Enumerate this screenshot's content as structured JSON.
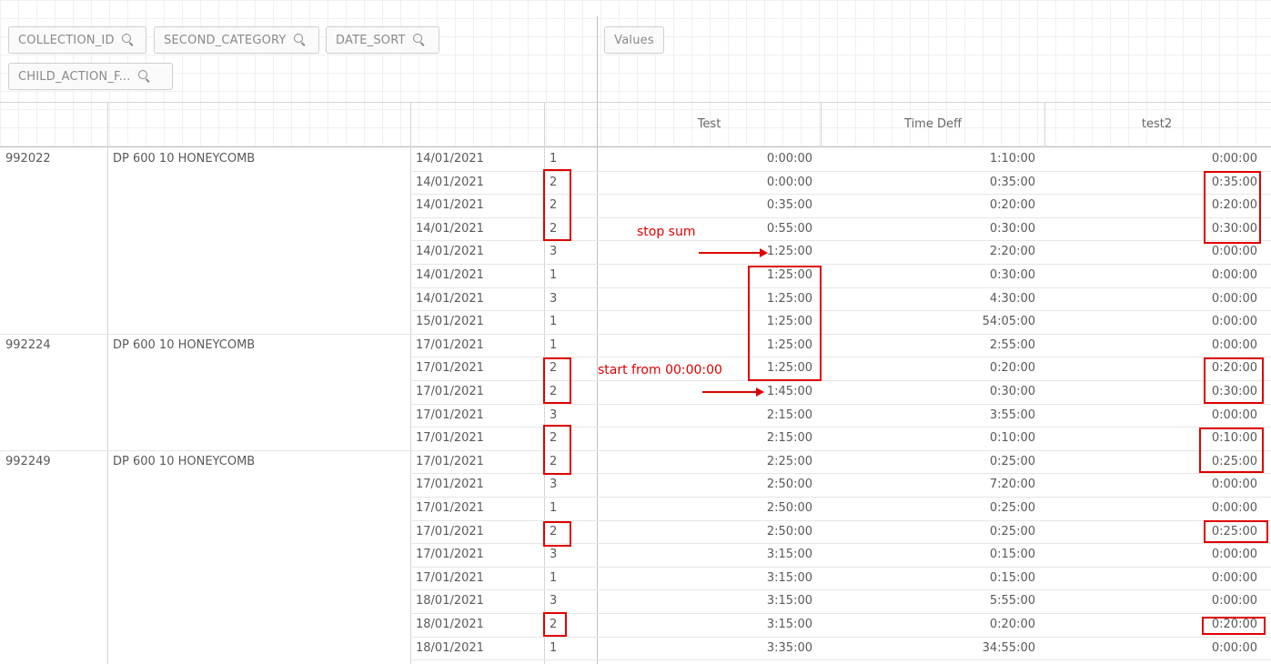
{
  "dimensions": [
    {
      "label": "COLLECTION_ID"
    },
    {
      "label": "SECOND_CATEGORY"
    },
    {
      "label": "DATE_SORT"
    },
    {
      "label": "CHILD_ACTION_F..."
    }
  ],
  "values_label": "Values",
  "columns": [
    "Test",
    "Time Deff",
    "test2"
  ],
  "rows": [
    {
      "id": "992022",
      "category": "DP 600 10 HONEYCOMB",
      "date": "14/01/2021",
      "action": "1",
      "test": "0:00:00",
      "diff": "1:10:00",
      "test2": "0:00:00"
    },
    {
      "id": "",
      "category": "",
      "date": "14/01/2021",
      "action": "2",
      "test": "0:00:00",
      "diff": "0:35:00",
      "test2": "0:35:00"
    },
    {
      "id": "",
      "category": "",
      "date": "14/01/2021",
      "action": "2",
      "test": "0:35:00",
      "diff": "0:20:00",
      "test2": "0:20:00"
    },
    {
      "id": "",
      "category": "",
      "date": "14/01/2021",
      "action": "2",
      "test": "0:55:00",
      "diff": "0:30:00",
      "test2": "0:30:00"
    },
    {
      "id": "",
      "category": "",
      "date": "14/01/2021",
      "action": "3",
      "test": "1:25:00",
      "diff": "2:20:00",
      "test2": "0:00:00"
    },
    {
      "id": "",
      "category": "",
      "date": "14/01/2021",
      "action": "1",
      "test": "1:25:00",
      "diff": "0:30:00",
      "test2": "0:00:00"
    },
    {
      "id": "",
      "category": "",
      "date": "14/01/2021",
      "action": "3",
      "test": "1:25:00",
      "diff": "4:30:00",
      "test2": "0:00:00"
    },
    {
      "id": "",
      "category": "",
      "date": "15/01/2021",
      "action": "1",
      "test": "1:25:00",
      "diff": "54:05:00",
      "test2": "0:00:00"
    },
    {
      "id": "992224",
      "category": "DP 600 10 HONEYCOMB",
      "date": "17/01/2021",
      "action": "1",
      "test": "1:25:00",
      "diff": "2:55:00",
      "test2": "0:00:00"
    },
    {
      "id": "",
      "category": "",
      "date": "17/01/2021",
      "action": "2",
      "test": "1:25:00",
      "diff": "0:20:00",
      "test2": "0:20:00"
    },
    {
      "id": "",
      "category": "",
      "date": "17/01/2021",
      "action": "2",
      "test": "1:45:00",
      "diff": "0:30:00",
      "test2": "0:30:00"
    },
    {
      "id": "",
      "category": "",
      "date": "17/01/2021",
      "action": "3",
      "test": "2:15:00",
      "diff": "3:55:00",
      "test2": "0:00:00"
    },
    {
      "id": "",
      "category": "",
      "date": "17/01/2021",
      "action": "2",
      "test": "2:15:00",
      "diff": "0:10:00",
      "test2": "0:10:00"
    },
    {
      "id": "992249",
      "category": "DP 600 10 HONEYCOMB",
      "date": "17/01/2021",
      "action": "2",
      "test": "2:25:00",
      "diff": "0:25:00",
      "test2": "0:25:00"
    },
    {
      "id": "",
      "category": "",
      "date": "17/01/2021",
      "action": "3",
      "test": "2:50:00",
      "diff": "7:20:00",
      "test2": "0:00:00"
    },
    {
      "id": "",
      "category": "",
      "date": "17/01/2021",
      "action": "1",
      "test": "2:50:00",
      "diff": "0:25:00",
      "test2": "0:00:00"
    },
    {
      "id": "",
      "category": "",
      "date": "17/01/2021",
      "action": "2",
      "test": "2:50:00",
      "diff": "0:25:00",
      "test2": "0:25:00"
    },
    {
      "id": "",
      "category": "",
      "date": "17/01/2021",
      "action": "3",
      "test": "3:15:00",
      "diff": "0:15:00",
      "test2": "0:00:00"
    },
    {
      "id": "",
      "category": "",
      "date": "17/01/2021",
      "action": "1",
      "test": "3:15:00",
      "diff": "0:15:00",
      "test2": "0:00:00"
    },
    {
      "id": "",
      "category": "",
      "date": "18/01/2021",
      "action": "3",
      "test": "3:15:00",
      "diff": "5:55:00",
      "test2": "0:00:00"
    },
    {
      "id": "",
      "category": "",
      "date": "18/01/2021",
      "action": "2",
      "test": "3:15:00",
      "diff": "0:20:00",
      "test2": "0:20:00"
    },
    {
      "id": "",
      "category": "",
      "date": "18/01/2021",
      "action": "1",
      "test": "3:35:00",
      "diff": "34:55:00",
      "test2": "0:00:00"
    }
  ],
  "annotations": {
    "stop_sum": "stop sum",
    "start_from": "start from 00:00:00",
    "color": "#e00000"
  }
}
